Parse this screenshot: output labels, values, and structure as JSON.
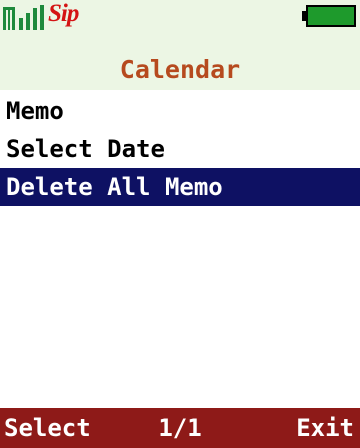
{
  "status_bar": {
    "logo_text": "Sip",
    "signal_icon": "signal-strength-icon",
    "battery_icon": "battery-full-icon",
    "battery_level": 1.0
  },
  "title": "Calendar",
  "menu": {
    "items": [
      {
        "label": "Memo"
      },
      {
        "label": "Select Date"
      },
      {
        "label": "Delete All Memo"
      }
    ],
    "selected_index": 2
  },
  "softkeys": {
    "left": "Select",
    "center": "1/1",
    "right": "Exit"
  },
  "colors": {
    "header_background": "#ecf6e4",
    "title_text": "#b64a1e",
    "highlight": "#0e1163",
    "softkey_bar": "#8e1a18",
    "battery_fill": "#1e9a2c",
    "signal": "#1e8a3c",
    "logo": "#d41414"
  }
}
